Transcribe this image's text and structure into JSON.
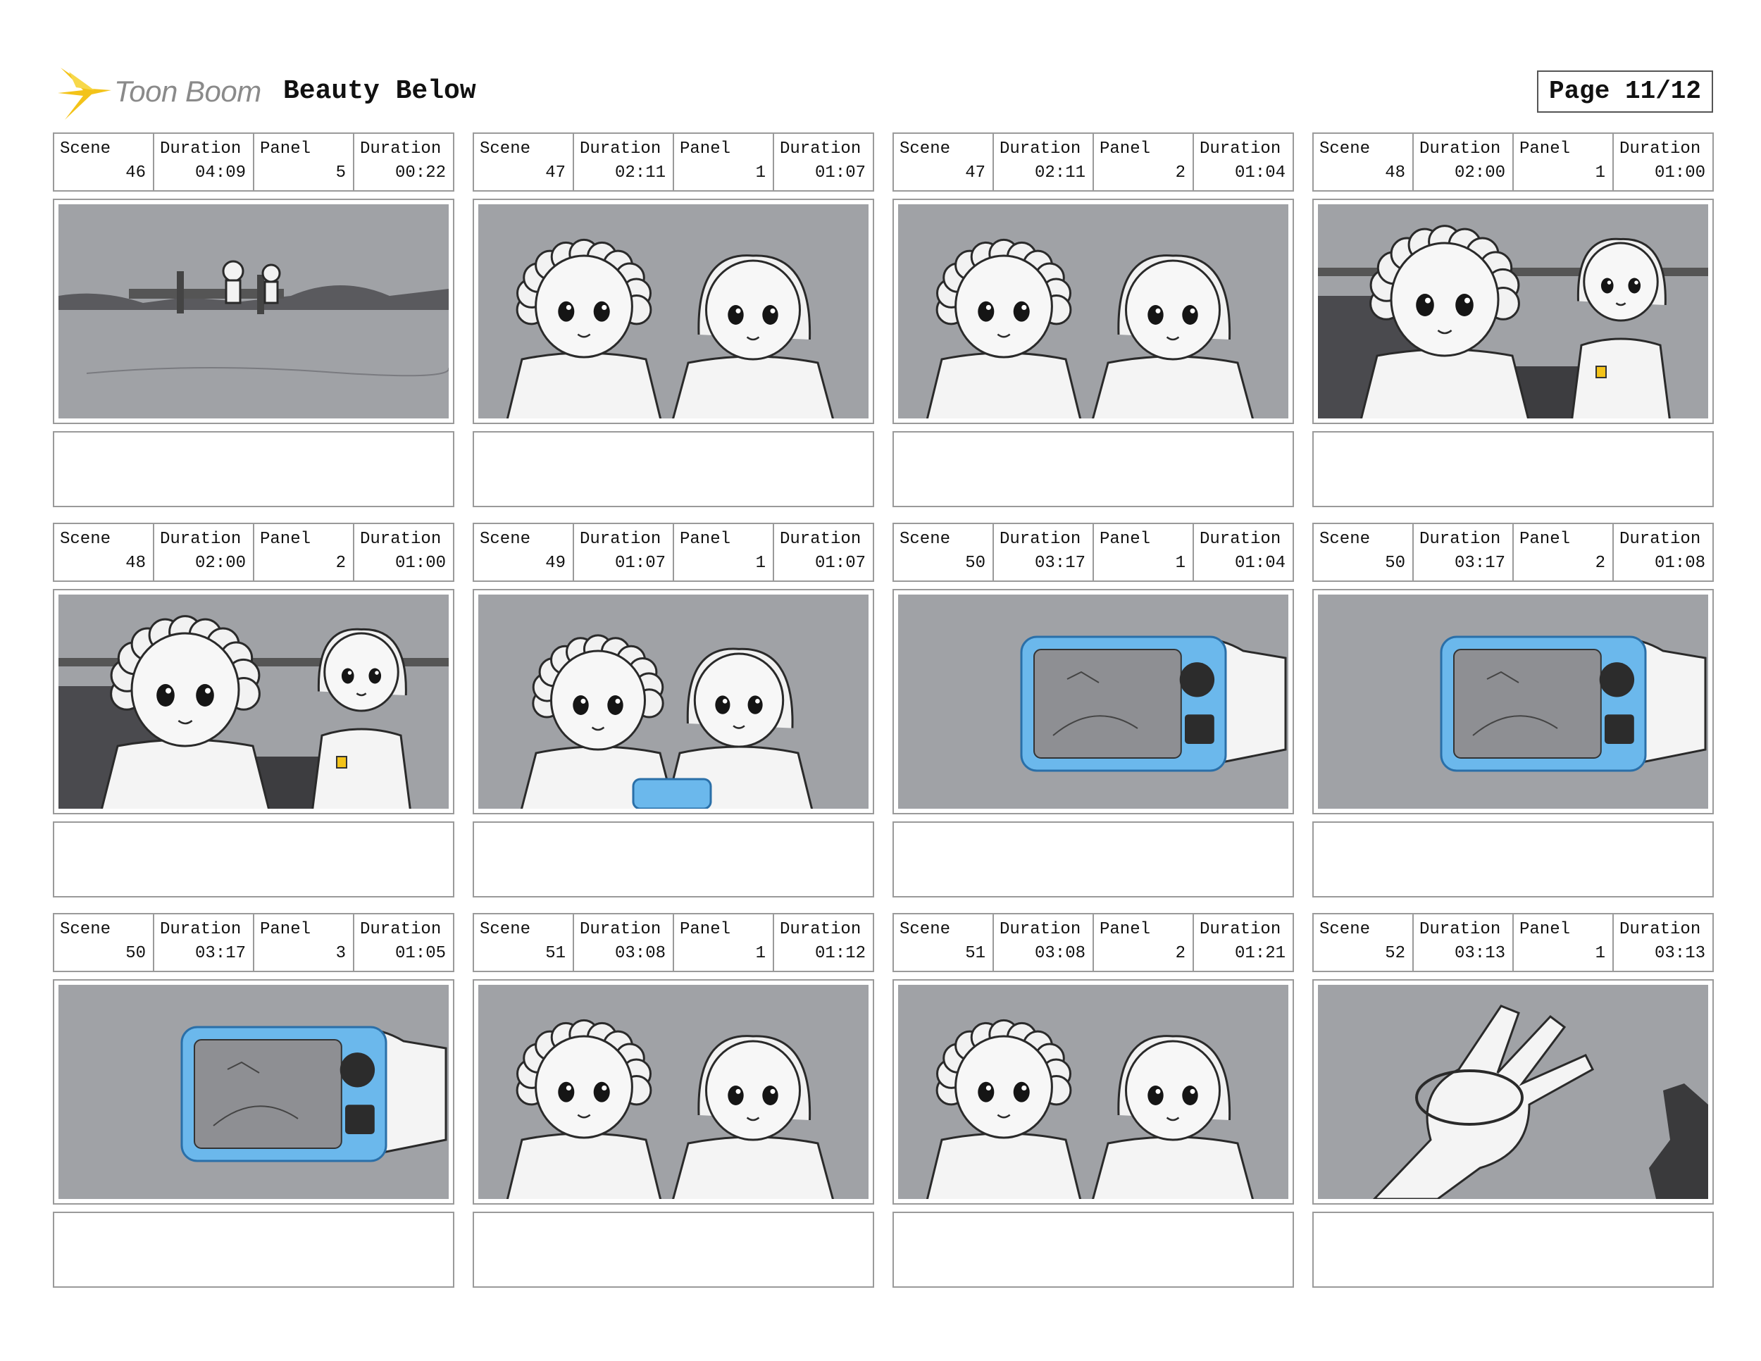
{
  "header": {
    "logo_text": "Toon Boom",
    "project_title": "Beauty Below",
    "page_label": "Page 11/12"
  },
  "labels": {
    "scene": "Scene",
    "duration": "Duration",
    "panel": "Panel"
  },
  "colors": {
    "frame_background": "#a0a2a6",
    "device_blue": "#6bb8ec",
    "logo_yellow": "#f3c319"
  },
  "panels": [
    {
      "scene": "46",
      "scene_duration": "04:09",
      "panel": "5",
      "panel_duration": "00:22",
      "art": "wide-shot-dock-two-kids",
      "notes": ""
    },
    {
      "scene": "47",
      "scene_duration": "02:11",
      "panel": "1",
      "panel_duration": "01:07",
      "art": "two-kids-closeup",
      "notes": ""
    },
    {
      "scene": "47",
      "scene_duration": "02:11",
      "panel": "2",
      "panel_duration": "01:04",
      "art": "two-kids-closeup",
      "notes": ""
    },
    {
      "scene": "48",
      "scene_duration": "02:00",
      "panel": "1",
      "panel_duration": "01:00",
      "art": "kids-on-couch",
      "notes": ""
    },
    {
      "scene": "48",
      "scene_duration": "02:00",
      "panel": "2",
      "panel_duration": "01:00",
      "art": "kids-on-couch",
      "notes": ""
    },
    {
      "scene": "49",
      "scene_duration": "01:07",
      "panel": "1",
      "panel_duration": "01:07",
      "art": "kids-holding-device",
      "notes": ""
    },
    {
      "scene": "50",
      "scene_duration": "03:17",
      "panel": "1",
      "panel_duration": "01:04",
      "art": "hand-holding-blue-device",
      "notes": ""
    },
    {
      "scene": "50",
      "scene_duration": "03:17",
      "panel": "2",
      "panel_duration": "01:08",
      "art": "hand-holding-blue-device",
      "notes": ""
    },
    {
      "scene": "50",
      "scene_duration": "03:17",
      "panel": "3",
      "panel_duration": "01:05",
      "art": "hand-holding-blue-device",
      "notes": ""
    },
    {
      "scene": "51",
      "scene_duration": "03:08",
      "panel": "1",
      "panel_duration": "01:12",
      "art": "two-kids-closeup",
      "notes": ""
    },
    {
      "scene": "51",
      "scene_duration": "03:08",
      "panel": "2",
      "panel_duration": "01:21",
      "art": "two-kids-closeup",
      "notes": ""
    },
    {
      "scene": "52",
      "scene_duration": "03:13",
      "panel": "1",
      "panel_duration": "03:13",
      "art": "hand-with-bracelet",
      "notes": ""
    }
  ]
}
